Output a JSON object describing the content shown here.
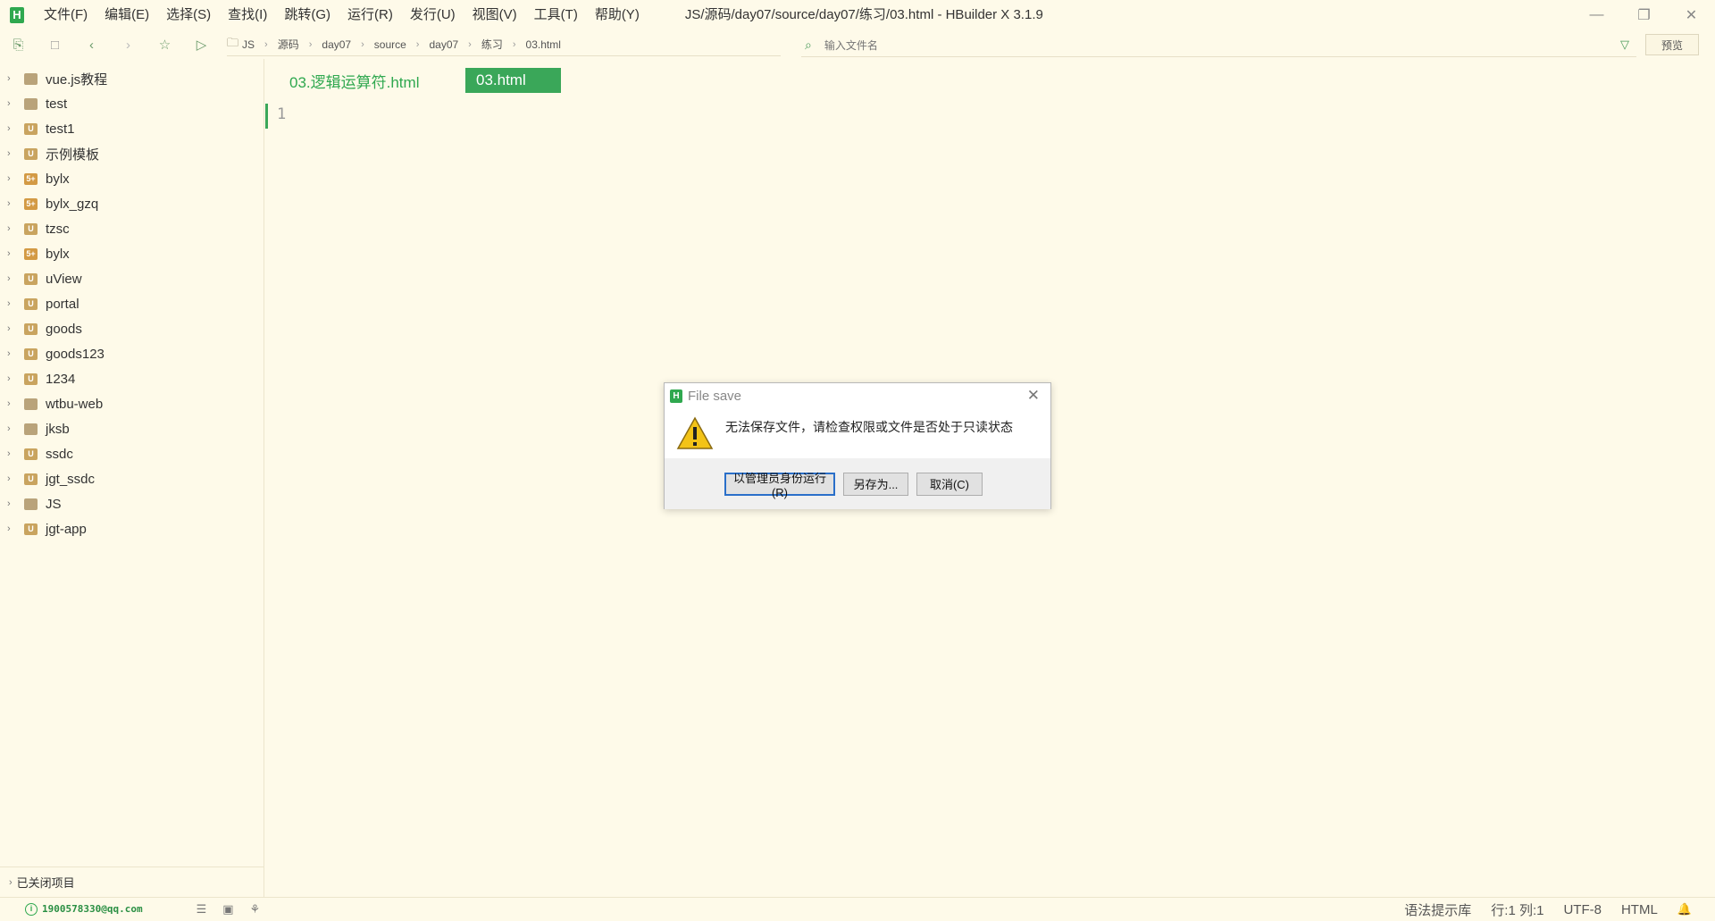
{
  "app": {
    "title": "JS/源码/day07/source/day07/练习/03.html - HBuilder X 3.1.9",
    "logo_letter": "H"
  },
  "menu": [
    {
      "label": "文件(F)"
    },
    {
      "label": "编辑(E)"
    },
    {
      "label": "选择(S)"
    },
    {
      "label": "查找(I)"
    },
    {
      "label": "跳转(G)"
    },
    {
      "label": "运行(R)"
    },
    {
      "label": "发行(U)"
    },
    {
      "label": "视图(V)"
    },
    {
      "label": "工具(T)"
    },
    {
      "label": "帮助(Y)"
    }
  ],
  "breadcrumb": [
    "JS",
    "源码",
    "day07",
    "source",
    "day07",
    "练习",
    "03.html"
  ],
  "search": {
    "placeholder": "输入文件名"
  },
  "preview_label": "预览",
  "projects": [
    {
      "label": "vue.js教程",
      "icon": "folder"
    },
    {
      "label": "test",
      "icon": "folder"
    },
    {
      "label": "test1",
      "icon": "uni"
    },
    {
      "label": "示例模板",
      "icon": "uni"
    },
    {
      "label": "bylx",
      "icon": "5plus"
    },
    {
      "label": "bylx_gzq",
      "icon": "5plus"
    },
    {
      "label": "tzsc",
      "icon": "uni"
    },
    {
      "label": "bylx",
      "icon": "5plus"
    },
    {
      "label": "uView",
      "icon": "uni"
    },
    {
      "label": "portal",
      "icon": "uni"
    },
    {
      "label": "goods",
      "icon": "uni"
    },
    {
      "label": "goods123",
      "icon": "uni"
    },
    {
      "label": "1234",
      "icon": "uni"
    },
    {
      "label": "wtbu-web",
      "icon": "folder"
    },
    {
      "label": "jksb",
      "icon": "folder"
    },
    {
      "label": "ssdc",
      "icon": "uni"
    },
    {
      "label": "jgt_ssdc",
      "icon": "uni"
    },
    {
      "label": "JS",
      "icon": "folder"
    },
    {
      "label": "jgt-app",
      "icon": "uni"
    }
  ],
  "closed_projects": "已关闭项目",
  "tabs": [
    {
      "label": "03.逻辑运算符.html",
      "active": false
    },
    {
      "label": "03.html",
      "active": true
    }
  ],
  "editor": {
    "line_number": "1"
  },
  "status": {
    "user": "1900578330@qq.com",
    "syntax": "语法提示库",
    "position": "行:1  列:1",
    "encoding": "UTF-8",
    "language": "HTML"
  },
  "dialog": {
    "title": "File save",
    "message": "无法保存文件，请检查权限或文件是否处于只读状态",
    "buttons": {
      "admin": "以管理员身份运行(R)",
      "save_as": "另存为...",
      "cancel": "取消(C)"
    }
  },
  "colors": {
    "accent": "#3aa759",
    "background": "#fefae9"
  }
}
